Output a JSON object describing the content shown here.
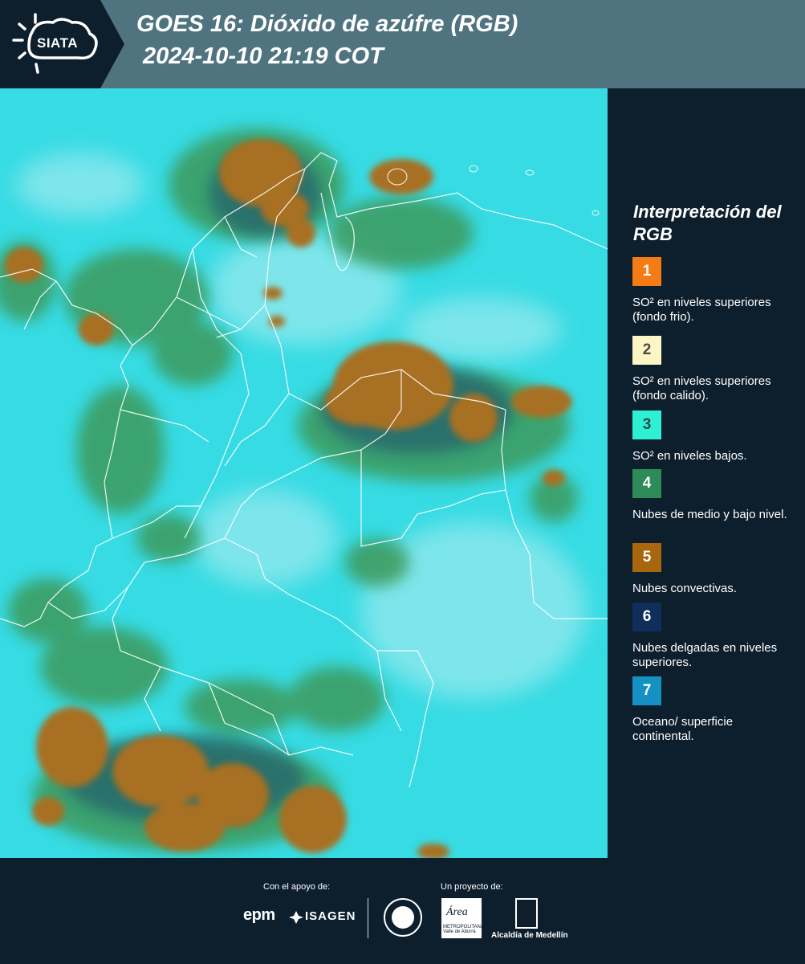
{
  "header": {
    "logo_text": "SIATA",
    "title_line1": "GOES 16: Dióxido de azúfre (RGB)",
    "title_line2": "2024-10-10 21:19 COT"
  },
  "legend": {
    "title": "Interpretación del RGB",
    "items": [
      {
        "number": "1",
        "color": "#f57c14",
        "text_color": "#ffffff",
        "label": "SO² en niveles superiores (fondo frio)."
      },
      {
        "number": "2",
        "color": "#fdf5c4",
        "text_color": "#4a4a4a",
        "label": "SO² en niveles superiores (fondo calido)."
      },
      {
        "number": "3",
        "color": "#2ef0d2",
        "text_color": "#2a4a4a",
        "label": "SO² en niveles bajos."
      },
      {
        "number": "4",
        "color": "#2e8a58",
        "text_color": "#ffffff",
        "label": "Nubes de medio y bajo nivel."
      },
      {
        "number": "5",
        "color": "#a8660f",
        "text_color": "#ffffff",
        "label": "Nubes convectivas."
      },
      {
        "number": "6",
        "color": "#102e5c",
        "text_color": "#ffffff",
        "label": "Nubes delgadas en niveles superiores."
      },
      {
        "number": "7",
        "color": "#1490c2",
        "text_color": "#ffffff",
        "label": "Oceano/ superficie continental."
      }
    ]
  },
  "footer": {
    "support_label": "Con el apoyo de:",
    "project_label": "Un proyecto de:",
    "epm": "epm",
    "isagen": "ISAGEN",
    "area": "Área",
    "area_sub": "METROPOLITANA Valle de Aburrá",
    "alcaldia": "Alcaldía de Medellín"
  },
  "colors": {
    "header_bg": "#4f7480",
    "panel_bg": "#0d1f2d",
    "map_background": "#2ee0e4",
    "convective_cloud": "#a8660f",
    "mid_low_cloud": "#2e8a58"
  }
}
